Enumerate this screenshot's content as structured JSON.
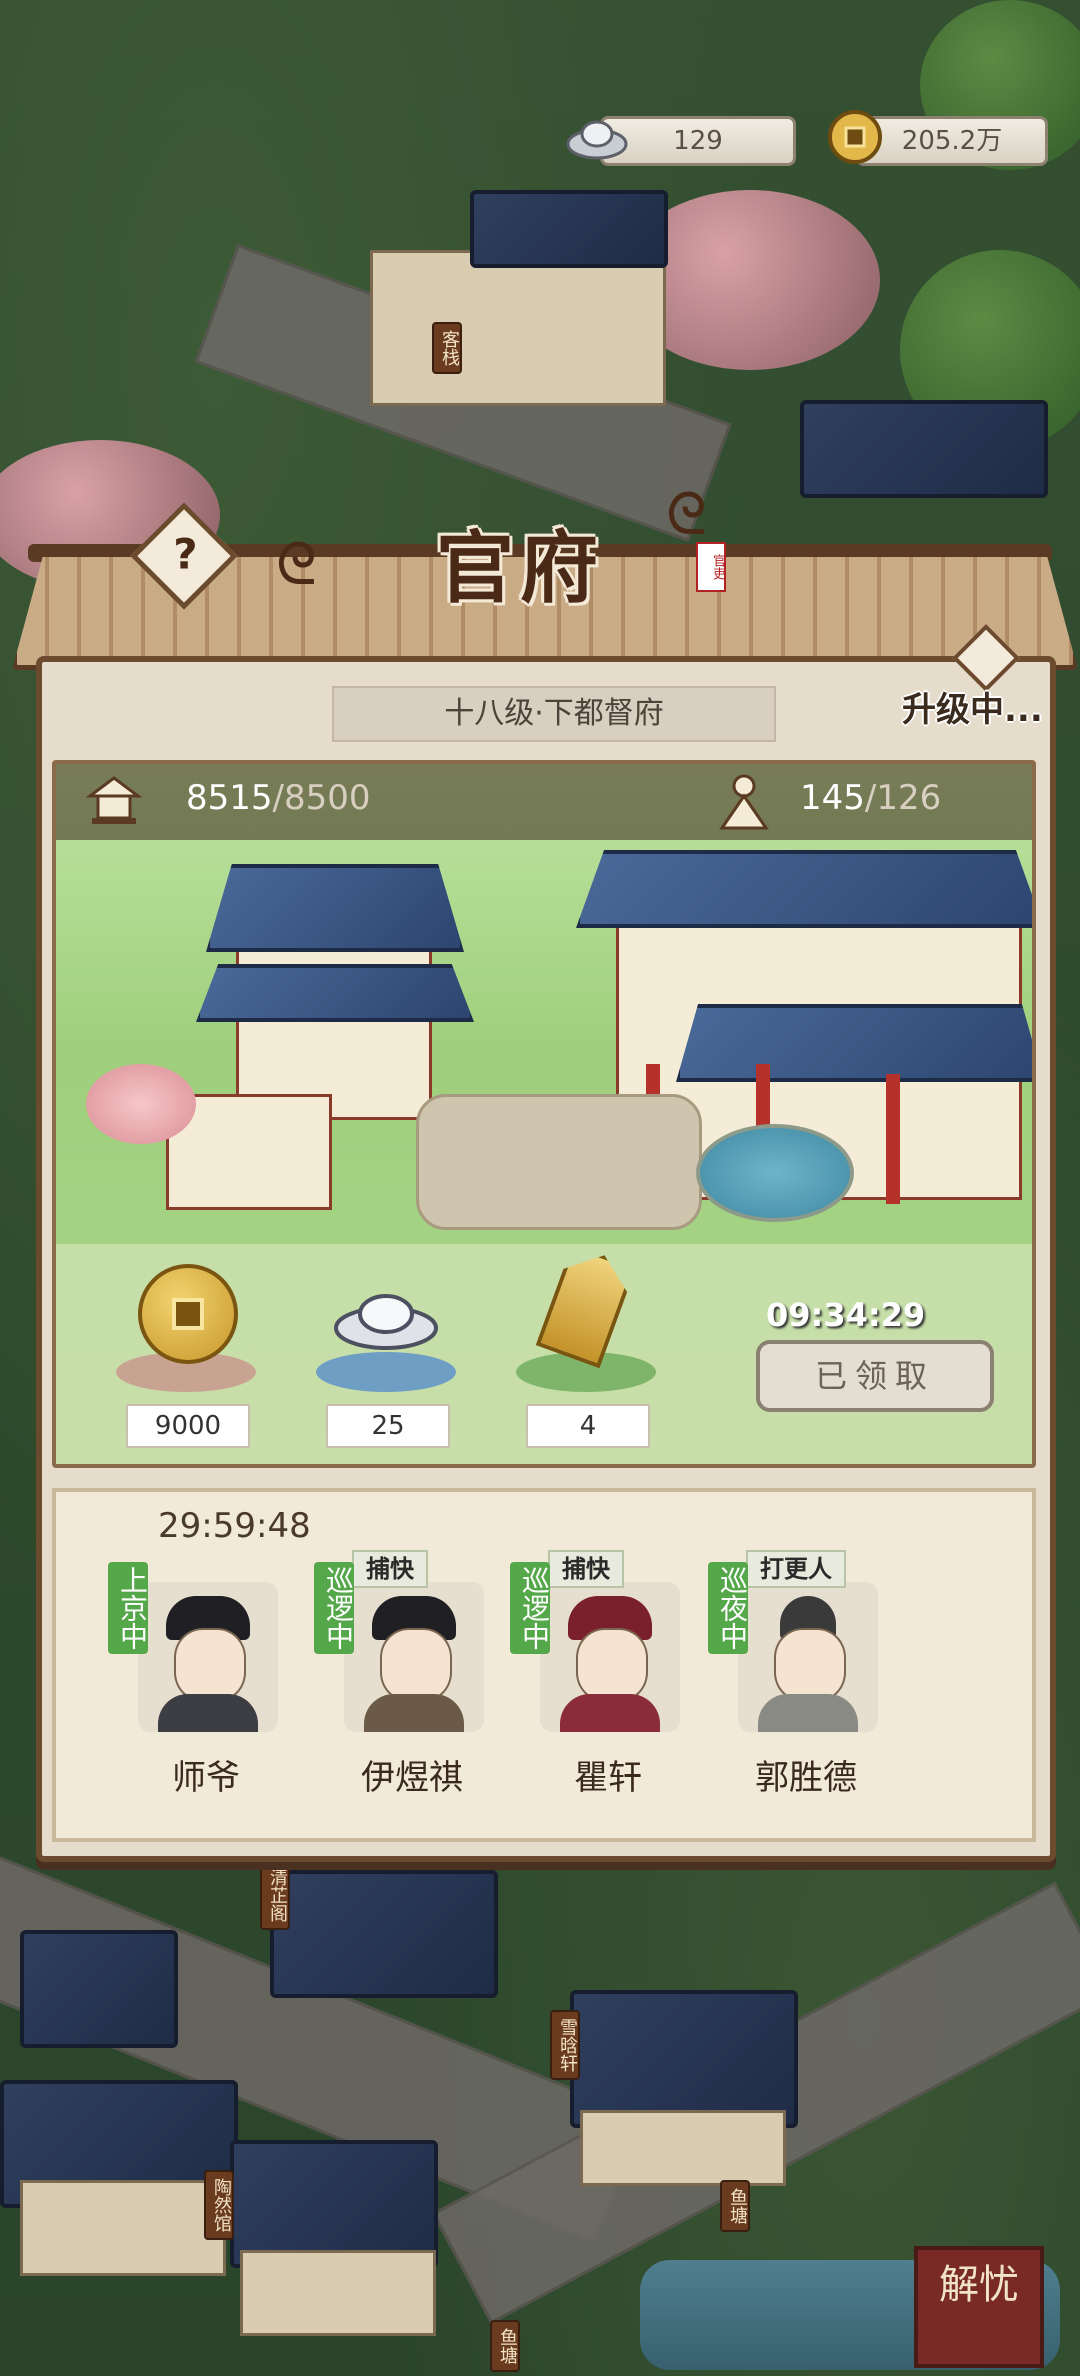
{
  "currency": {
    "silver": {
      "icon": "silver-ingot-icon",
      "value": "129"
    },
    "copper": {
      "icon": "copper-coin-icon",
      "value": "205.2万"
    }
  },
  "map_labels": {
    "inn": "客栈",
    "qingzhi": "清芷阁",
    "xuehan": "雪晗轩",
    "taoran": "陶然馆",
    "yutang1": "鱼塘",
    "yutang2": "鱼塘"
  },
  "panel": {
    "title": "官府",
    "seal": "官吏",
    "help_label": "?",
    "level_text": "十八级·下都督府",
    "upgrade_status": "升级中...",
    "prosperity": {
      "icon": "pavilion-icon",
      "current": "8515",
      "max": "/8500"
    },
    "population": {
      "icon": "official-figure-icon",
      "current": "145",
      "max": "/126"
    },
    "rewards": [
      {
        "icon": "copper-coin-icon",
        "amount": "9000"
      },
      {
        "icon": "silver-ingot-icon",
        "amount": "25"
      },
      {
        "icon": "gold-token-icon",
        "amount": "4"
      }
    ],
    "reward_timer": "09:34:29",
    "claim_button": "已领取"
  },
  "staff": {
    "timer": "29:59:48",
    "members": [
      {
        "name": "师爷",
        "status": "上京中",
        "role": ""
      },
      {
        "name": "伊煜祺",
        "status": "巡逻中",
        "role": "捕快"
      },
      {
        "name": "瞿轩",
        "status": "巡逻中",
        "role": "捕快"
      },
      {
        "name": "郭胜德",
        "status": "巡夜中",
        "role": "打更人"
      }
    ]
  },
  "corner_button": "解忧",
  "colors": {
    "panel_bg": "#e6dccb",
    "wood_frame": "#6c4a2e",
    "status_green": "#55a84a",
    "title_brown": "#4a2a16"
  }
}
